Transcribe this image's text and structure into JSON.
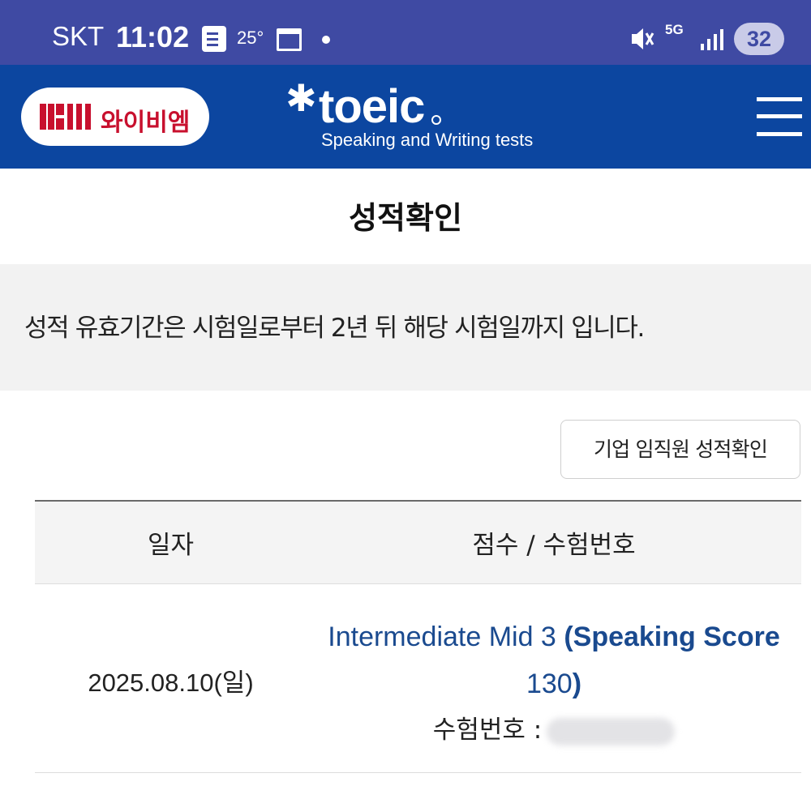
{
  "status_bar": {
    "carrier": "SKT",
    "time": "11:02",
    "temperature": "25°",
    "network": "5G",
    "battery": "32"
  },
  "header": {
    "ybm_logo_text": "와이비엠",
    "toeic_word": "toeic",
    "toeic_subtitle": "Speaking and Writing tests"
  },
  "page": {
    "title": "성적확인",
    "notice": "성적 유효기간은 시험일로부터 2년 뒤 해당 시험일까지 입니다.",
    "corporate_button": "기업 임직원 성적확인"
  },
  "table": {
    "headers": [
      "일자",
      "점수 / 수험번호"
    ],
    "rows": [
      {
        "date": "2025.08.10(일)",
        "level": "Intermediate Mid 3",
        "score_prefix": "(Speaking Score",
        "score_value": "130",
        "score_suffix": ")",
        "exam_number_label": "수험번호 :"
      }
    ]
  },
  "colors": {
    "status_bar": "#3f4aa3",
    "header": "#0c46a0",
    "score_text": "#1a4a8f",
    "ybm_red": "#c8102e"
  }
}
